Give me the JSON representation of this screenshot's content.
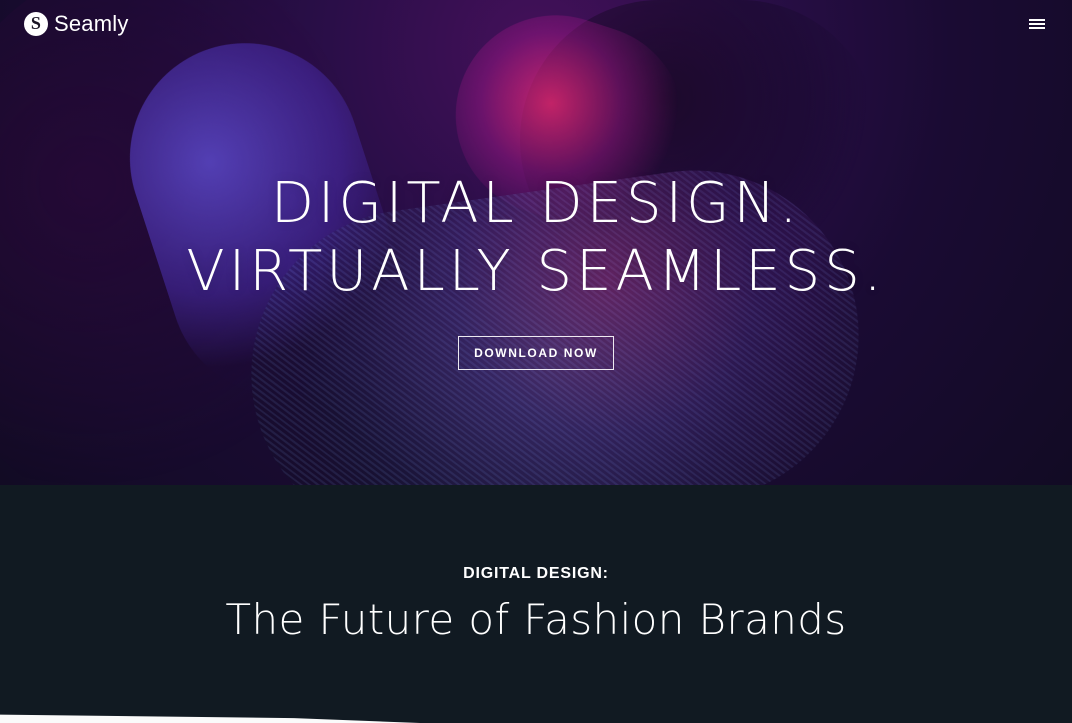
{
  "header": {
    "brand_name": "Seamly",
    "brand_mark_letter": "S",
    "menu_icon": "hamburger-menu-icon"
  },
  "hero": {
    "title_line_1": "DIGITAL DESIGN.",
    "title_line_2": "VIRTUALLY SEAMLESS.",
    "cta_label": "DOWNLOAD NOW"
  },
  "section": {
    "eyebrow": "DIGITAL DESIGN:",
    "heading": "The Future of Fashion Brands"
  },
  "colors": {
    "page_bg": "#111a22",
    "text": "#ffffff",
    "hero_magenta": "#ff2d78",
    "hero_violet": "#7060ff"
  }
}
